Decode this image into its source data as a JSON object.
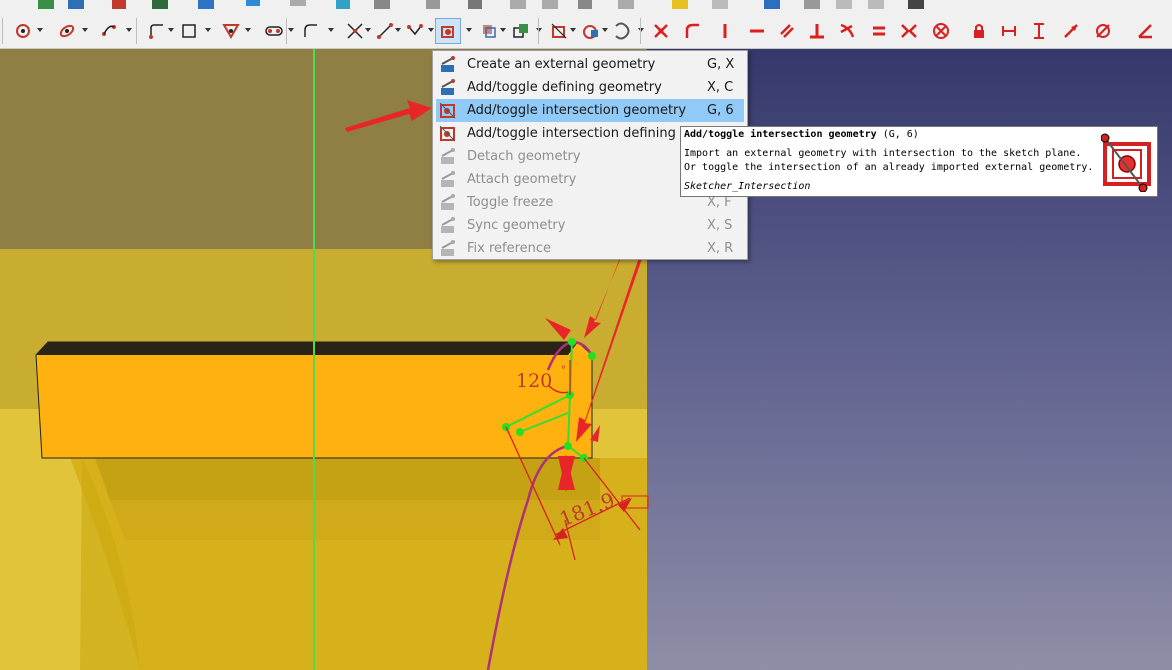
{
  "toolbar": {
    "icons": [
      "datum-point-icon",
      "datum-plane-icon",
      "chamfer-solid-icon",
      "zoom-icon",
      "arrow-left-icon",
      "arrow-up-icon",
      "arrow-redo-icon",
      "point-icon",
      "circle-icon",
      "conic-icon",
      "bspline-icon",
      "polyline-icon",
      "rectangle-icon",
      "polygon-icon",
      "slot-icon",
      "fillet-icon",
      "trim-icon",
      "extend-icon",
      "split-icon",
      "external-geometry-icon",
      "carbon-copy-icon",
      "intersection-icon",
      "clone-icon",
      "copy-icon",
      "array-icon"
    ],
    "constraint_icons": [
      "constraint-coincident-icon",
      "constraint-point-on-object-icon",
      "constraint-vertical-icon",
      "constraint-horizontal-icon",
      "constraint-parallel-icon",
      "constraint-perpendicular-icon",
      "constraint-tangent-icon",
      "constraint-equal-icon",
      "constraint-symmetric-icon",
      "constraint-block-icon",
      "constraint-lock-icon",
      "constraint-horizontal-distance-icon",
      "constraint-vertical-distance-icon",
      "constraint-distance-icon",
      "constraint-radius-icon",
      "constraint-angle-icon"
    ]
  },
  "menu": {
    "items": [
      {
        "label": "Create an external geometry",
        "shortcut": "G, X",
        "disabled": false,
        "highlight": false
      },
      {
        "label": "Add/toggle defining geometry",
        "shortcut": "X, C",
        "disabled": false,
        "highlight": false
      },
      {
        "label": "Add/toggle intersection geometry",
        "shortcut": "G, 6",
        "disabled": false,
        "highlight": true
      },
      {
        "label": "Add/toggle intersection defining",
        "shortcut": "",
        "disabled": false,
        "highlight": false
      },
      {
        "label": "Detach geometry",
        "shortcut": "",
        "disabled": true,
        "highlight": false
      },
      {
        "label": "Attach geometry",
        "shortcut": "",
        "disabled": true,
        "highlight": false
      },
      {
        "label": "Toggle freeze",
        "shortcut": "X, F",
        "disabled": true,
        "highlight": false
      },
      {
        "label": "Sync geometry",
        "shortcut": "X, S",
        "disabled": true,
        "highlight": false
      },
      {
        "label": "Fix reference",
        "shortcut": "X, R",
        "disabled": true,
        "highlight": false
      }
    ]
  },
  "tooltip": {
    "title": "Add/toggle intersection geometry",
    "shortcut": "(G, 6)",
    "line1": "Import an external geometry with intersection to the sketch plane.",
    "line2": "Or toggle the intersection of an already imported external geometry.",
    "command": "Sketcher_Intersection",
    "icon": "intersection-icon"
  },
  "sketch": {
    "angle_label": "120",
    "angle_unit": "°",
    "distance_label": "181.9"
  },
  "colors": {
    "accent_red": "#e02020",
    "menu_highlight": "#91c9f7",
    "part_orange": "#ffb20f",
    "part_yellow": "#e1c43a",
    "sketch_green": "#33dd33",
    "curve_magenta": "#b0307a"
  }
}
